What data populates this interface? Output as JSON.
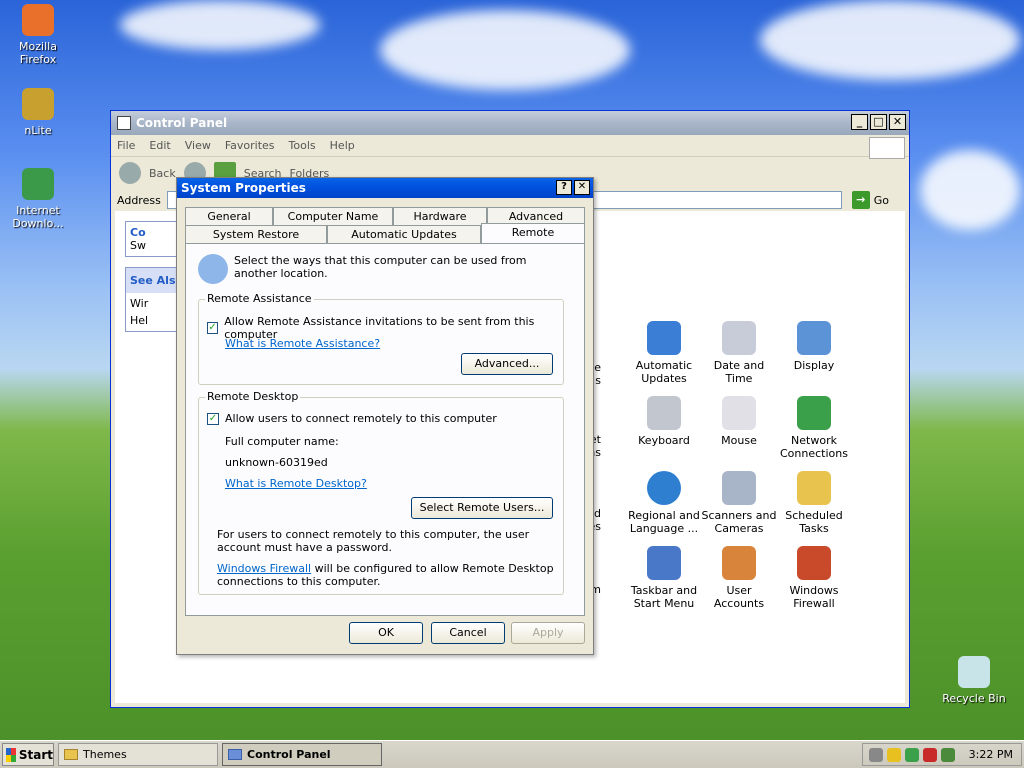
{
  "desktop": {
    "icons": [
      {
        "label": "Mozilla Firefox",
        "icon": "firefox-icon"
      },
      {
        "label": "nLite",
        "icon": "nlite-icon"
      },
      {
        "label": "Internet Downlo...",
        "icon": "internet-download-manager-icon"
      },
      {
        "label": "Recycle Bin",
        "icon": "recycle-bin-icon"
      }
    ]
  },
  "control_panel": {
    "title": "Control Panel",
    "menu": [
      "File",
      "Edit",
      "View",
      "Favorites",
      "Tools",
      "Help"
    ],
    "toolbar": {
      "back": "Back",
      "search": "Search",
      "folders": "Folders"
    },
    "address_label": "Address",
    "go_label": "Go",
    "left_pane": {
      "task_title": "Co",
      "task_item": "Sw",
      "see_also": "See Als",
      "see_items": [
        "Wir",
        "Hel"
      ]
    },
    "partial_icons": [
      "rative\ns",
      "net\nns",
      " and\nes",
      "em"
    ],
    "icons": [
      {
        "label": "Automatic Updates",
        "icon": "automatic-updates-icon",
        "color": "#3a7fd5"
      },
      {
        "label": "Date and Time",
        "icon": "date-time-icon",
        "color": "#c8ccd8"
      },
      {
        "label": "Display",
        "icon": "display-icon",
        "color": "#5c92d6"
      },
      {
        "label": "Keyboard",
        "icon": "keyboard-icon",
        "color": "#c2c6ce"
      },
      {
        "label": "Mouse",
        "icon": "mouse-icon",
        "color": "#e0e0e6"
      },
      {
        "label": "Network Connections",
        "icon": "network-connections-icon",
        "color": "#3aa04a"
      },
      {
        "label": "Regional and Language ...",
        "icon": "globe-icon",
        "color": "#2f7fd0"
      },
      {
        "label": "Scanners and Cameras",
        "icon": "scanner-camera-icon",
        "color": "#a8b4c8"
      },
      {
        "label": "Scheduled Tasks",
        "icon": "scheduled-tasks-icon",
        "color": "#e8c44e"
      },
      {
        "label": "Taskbar and Start Menu",
        "icon": "taskbar-icon",
        "color": "#4a78c8"
      },
      {
        "label": "User Accounts",
        "icon": "user-accounts-icon",
        "color": "#d8843a"
      },
      {
        "label": "Windows Firewall",
        "icon": "firewall-icon",
        "color": "#c84a2a"
      }
    ]
  },
  "dialog": {
    "title": "System Properties",
    "help_btn": "?",
    "close_btn": "✕",
    "tabs_row1": [
      "General",
      "Computer Name",
      "Hardware",
      "Advanced"
    ],
    "tabs_row2": [
      "System Restore",
      "Automatic Updates",
      "Remote"
    ],
    "intro": "Select the ways that this computer can be used from another location.",
    "remote_assistance": {
      "title": "Remote Assistance",
      "checkbox": "Allow Remote Assistance invitations to be sent from this computer",
      "checked": true,
      "link": "What is Remote Assistance?",
      "advanced": "Advanced..."
    },
    "remote_desktop": {
      "title": "Remote Desktop",
      "checkbox": "Allow users to connect remotely to this computer",
      "checked": true,
      "full_name_label": "Full computer name:",
      "full_name": "unknown-60319ed",
      "link": "What is Remote Desktop?",
      "select_users": "Select Remote Users...",
      "note": "For users to connect remotely to this computer, the user account must have a password.",
      "firewall_link": "Windows Firewall",
      "firewall_note": " will be configured to allow Remote Desktop connections to this computer."
    },
    "buttons": {
      "ok": "OK",
      "cancel": "Cancel",
      "apply": "Apply"
    }
  },
  "taskbar": {
    "start": "Start",
    "tasks": [
      {
        "label": "Themes"
      },
      {
        "label": "Control Panel"
      }
    ],
    "clock": "3:22 PM"
  }
}
